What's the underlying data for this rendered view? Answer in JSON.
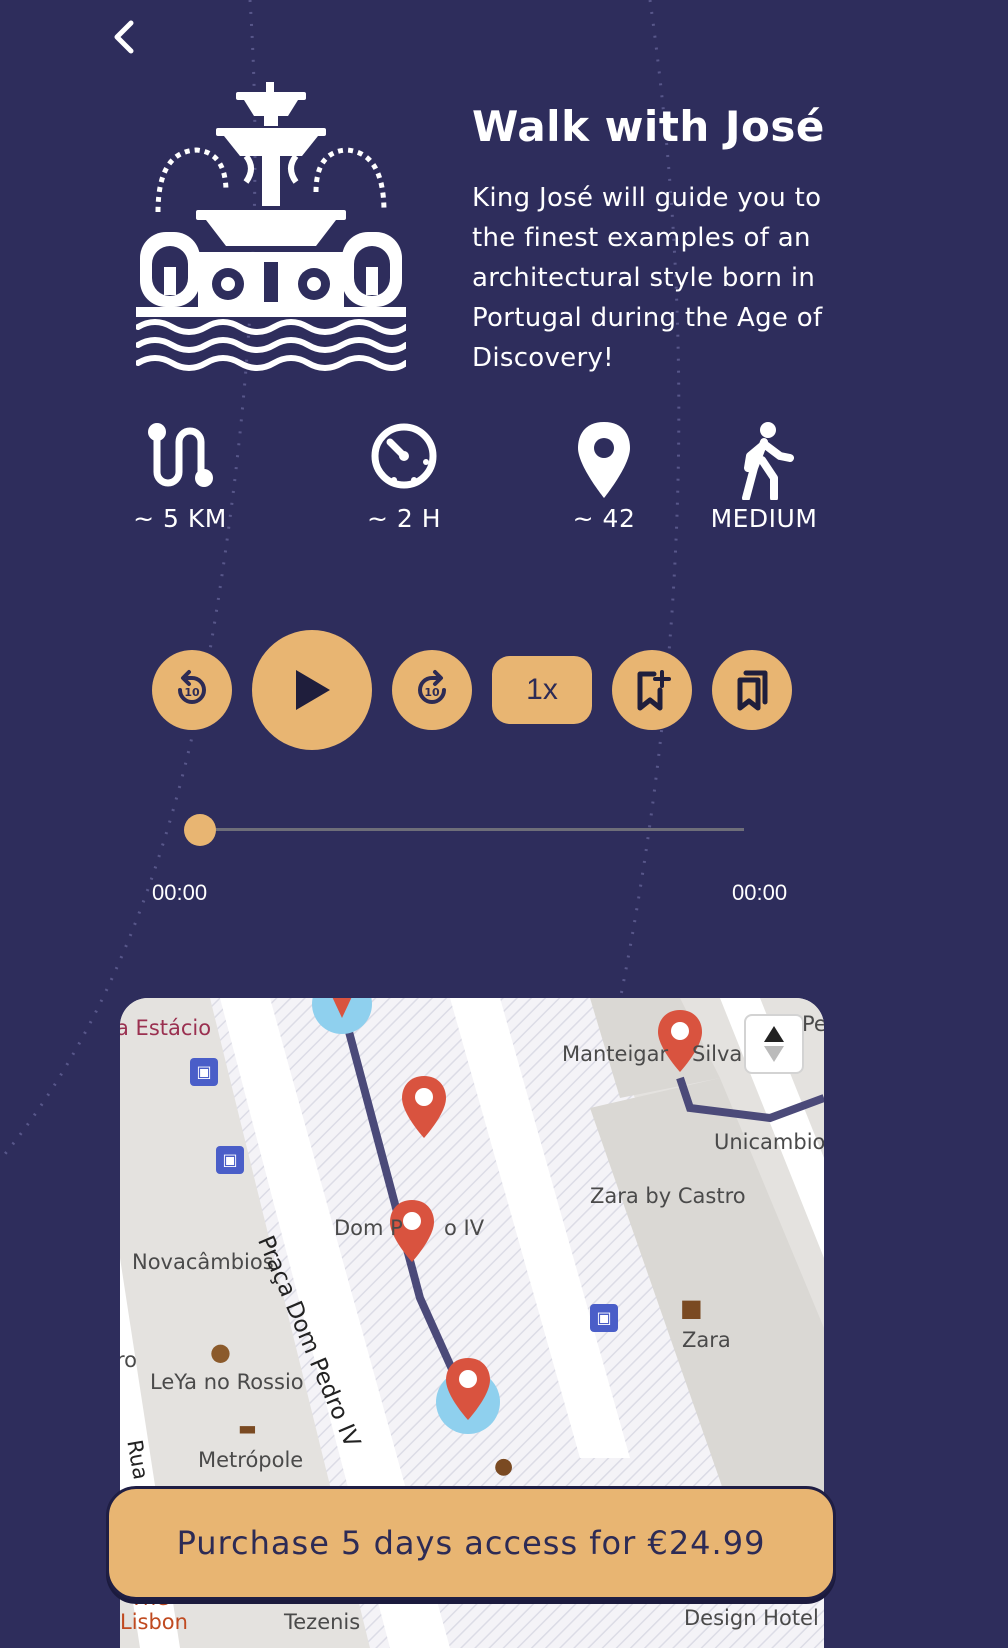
{
  "tour": {
    "title": "Walk with José",
    "description": "King José will guide you to the finest examples of an architectural style born in Portugal during the Age of Discovery!"
  },
  "stats": [
    {
      "label": "~ 5 KM",
      "icon": "route-icon"
    },
    {
      "label": "~ 2 H",
      "icon": "timer-icon"
    },
    {
      "label": "~ 42",
      "icon": "location-pin-icon"
    },
    {
      "label": "MEDIUM",
      "icon": "walking-person-icon"
    }
  ],
  "player": {
    "speed_label": "1x",
    "rewind_seconds": "10",
    "forward_seconds": "10",
    "current_time": "00:00",
    "total_time": "00:00",
    "progress": 0
  },
  "map": {
    "labels": [
      "a Estácio",
      "Manteigar",
      "Silva",
      "Pe",
      "Unicambio",
      "Zara by Castro",
      "Dom P",
      "o IV",
      "Novacâmbios",
      "Praça Dom Pedro IV",
      "Zara",
      "ro",
      "LeYa no Rossio",
      "Metrópole",
      "Rua",
      "The",
      "Lisbon",
      "Tezenis",
      "Design Hotel"
    ]
  },
  "purchase": {
    "label": "Purchase 5 days access for €24.99"
  },
  "colors": {
    "background": "#2e2d5c",
    "accent": "#e8b572",
    "marker": "#d9533f",
    "route": "#4b4a79"
  }
}
